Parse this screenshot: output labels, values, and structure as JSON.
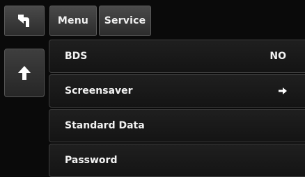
{
  "tabs": {
    "back_icon": "back-arrow-icon",
    "menu_label": "Menu",
    "service_label": "Service"
  },
  "side": {
    "up_icon": "up-arrow-icon"
  },
  "list": {
    "items": [
      {
        "label": "BDS",
        "value": "NO"
      },
      {
        "label": "Screensaver",
        "icon": "right-arrow-icon"
      },
      {
        "label": "Standard Data"
      },
      {
        "label": "Password"
      }
    ]
  }
}
